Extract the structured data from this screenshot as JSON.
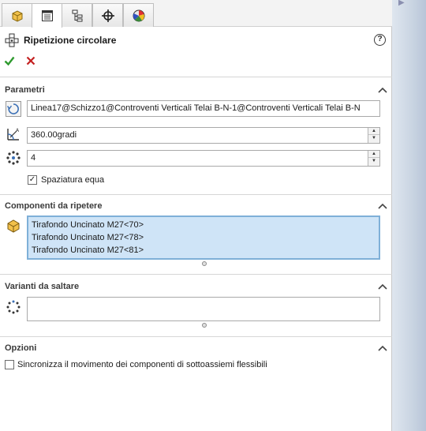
{
  "header": {
    "title": "Ripetizione circolare",
    "help": "?"
  },
  "tabs": [
    {
      "name": "featuremanager",
      "icon": "featuremanager-icon"
    },
    {
      "name": "propertymanager",
      "icon": "propertymanager-icon"
    },
    {
      "name": "configurationmanager",
      "icon": "configurationmanager-icon"
    },
    {
      "name": "dimxpertmanager",
      "icon": "dimxpert-icon"
    },
    {
      "name": "displaymanager",
      "icon": "displaymanager-icon"
    }
  ],
  "parametri": {
    "title": "Parametri",
    "axis": "Linea17@Schizzo1@Controventi Verticali Telai B-N-1@Controventi Verticali Telai B-N",
    "angle": "360.00gradi",
    "instances": "4",
    "equal_spacing_label": "Spaziatura equa",
    "equal_spacing_checked": true
  },
  "componenti": {
    "title": "Componenti da ripetere",
    "items": [
      "Tirafondo Uncinato M27<70>",
      "Tirafondo Uncinato M27<78>",
      "Tirafondo Uncinato M27<81>"
    ]
  },
  "varianti": {
    "title": "Varianti da saltare"
  },
  "opzioni": {
    "title": "Opzioni",
    "sync_label": "Sincronizza il movimento dei componenti di sottoassiemi flessibili",
    "sync_checked": false
  },
  "colors": {
    "accent_selection": "#cfe4f7",
    "ok_green": "#2e9a2e",
    "cancel_red": "#c42020"
  }
}
